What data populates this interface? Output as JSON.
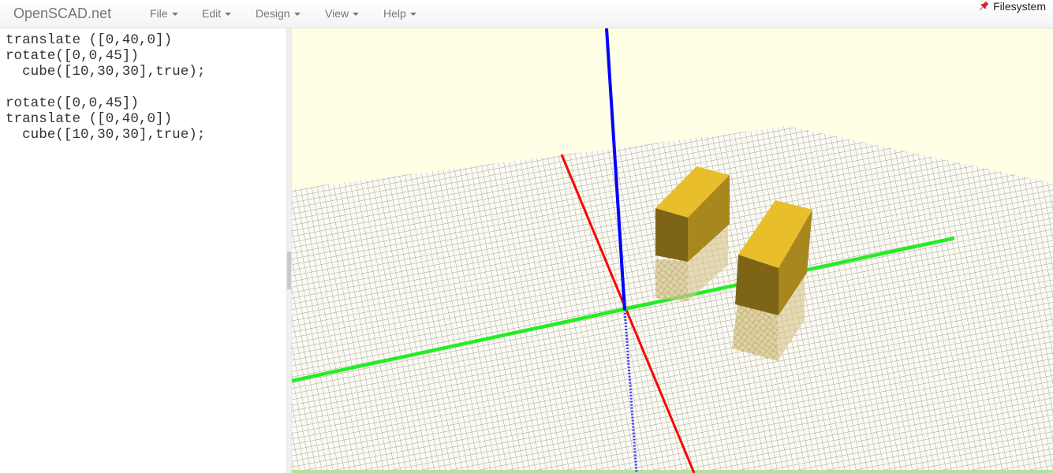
{
  "navbar": {
    "brand": "OpenSCAD.net",
    "menus": [
      {
        "label": "File"
      },
      {
        "label": "Edit"
      },
      {
        "label": "Design"
      },
      {
        "label": "View"
      },
      {
        "label": "Help"
      }
    ],
    "filesystem_label": "Filesystem",
    "filesystem_icon": "pushpin-icon"
  },
  "editor": {
    "lines": [
      "translate ([0,40,0])",
      "rotate([0,0,45])",
      "  cube([10,30,30],true);",
      "",
      "rotate([0,0,45])",
      "translate ([0,40,0])",
      "  cube([10,30,30],true);"
    ]
  },
  "viewport": {
    "background_color": "#ffffe5",
    "grid_color": "#fbfbf3",
    "grid_line_color": "#a3a39c",
    "axis_x_color": "#ff0000",
    "axis_y_color": "#00e000",
    "axis_z_color": "#0000ff",
    "cube_top_color": "#e8bf2a",
    "cube_front_color": "#7d6417",
    "cube_side_color": "#a8871f"
  }
}
